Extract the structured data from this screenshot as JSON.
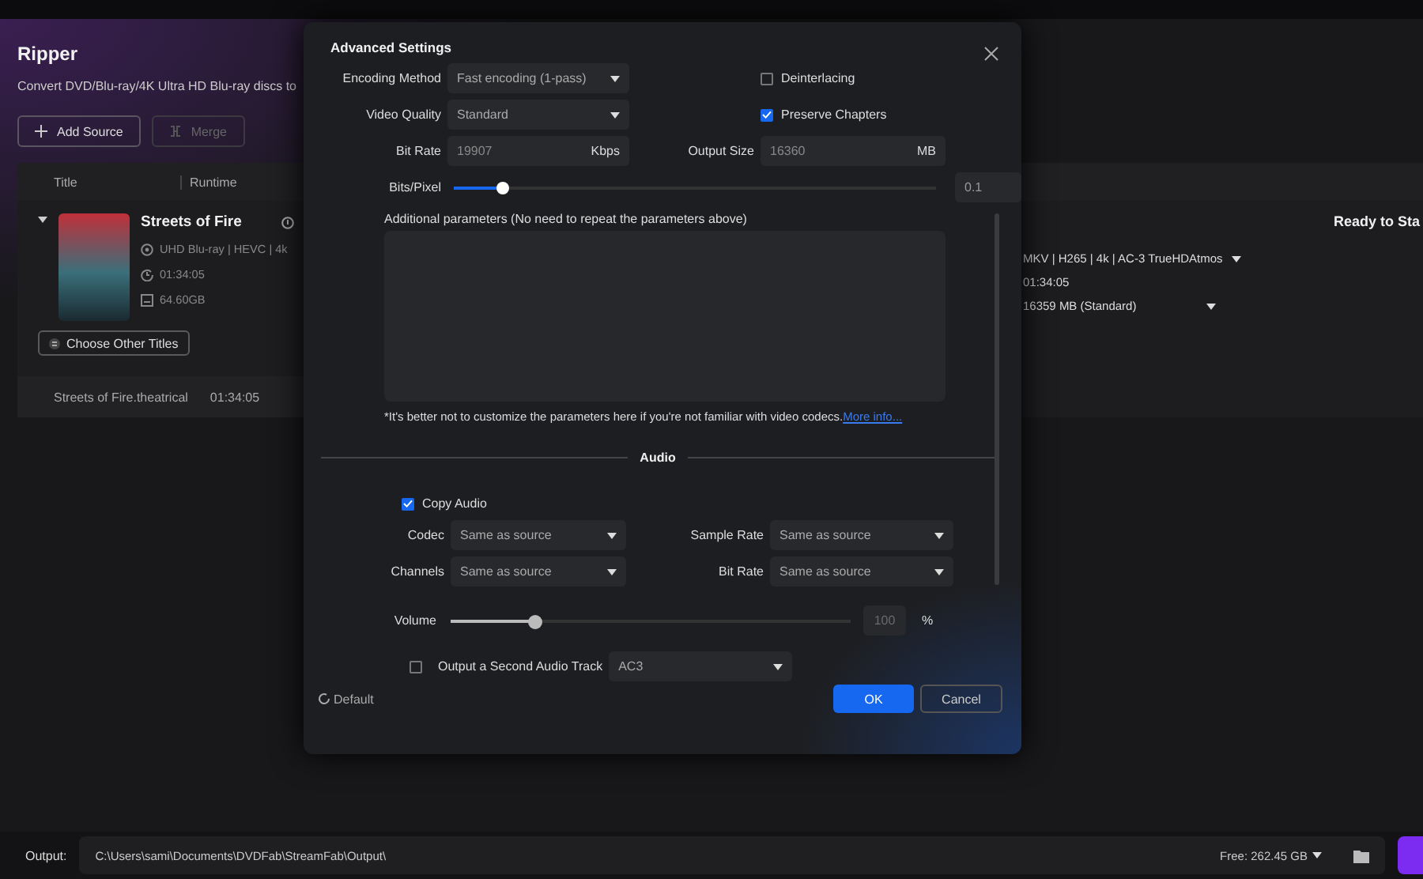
{
  "app": {
    "title": "Ripper",
    "subtitle": "Convert DVD/Blu-ray/4K Ultra HD Blu-ray discs to",
    "buttons": [
      {
        "label": "Add Source",
        "disabled": false
      },
      {
        "label": "Merge",
        "disabled": true
      }
    ]
  },
  "table": {
    "columns": [
      "Title",
      "Runtime"
    ],
    "source": {
      "expanded": true,
      "title": "Streets of Fire",
      "details": [
        "UHD Blu-ray | HEVC | 4k",
        "01:34:05",
        "64.60GB"
      ],
      "button": "Choose Other Titles",
      "profile": "MKV | H265 | 4k | AC-3 TrueHDAtmos",
      "runtime": "01:34:05",
      "size": "16359 MB (Standard)",
      "status": "Ready to Sta"
    },
    "titles": [
      {
        "name": "Streets of Fire.theatrical",
        "runtime": "01:34:05"
      }
    ]
  },
  "output": {
    "label": "Output:",
    "path": "C:\\Users\\sami\\Documents\\DVDFab\\StreamFab\\Output\\",
    "free": "Free: 262.45 GB"
  },
  "dialog": {
    "title": "Advanced Settings",
    "encoding_method": {
      "label": "Encoding Method",
      "value": "Fast encoding (1-pass)"
    },
    "deinterlacing": {
      "label": "Deinterlacing",
      "checked": false
    },
    "video_quality": {
      "label": "Video Quality",
      "value": "Standard"
    },
    "preserve_chapters": {
      "label": "Preserve Chapters",
      "checked": true
    },
    "bit_rate": {
      "label": "Bit Rate",
      "value": "19907",
      "unit": "Kbps"
    },
    "output_size": {
      "label": "Output Size",
      "value": "16360",
      "unit": "MB"
    },
    "bits_pixel": {
      "label": "Bits/Pixel",
      "level": 0.1,
      "value": "0.1"
    },
    "additional": {
      "label": "Additional parameters (No need to repeat the parameters above)",
      "note": "*It's better not to customize the parameters here if you're not familiar with video codecs.",
      "link": "More info..."
    },
    "audio": {
      "heading": "Audio",
      "copy_audio": {
        "label": "Copy Audio",
        "checked": true
      },
      "fields": [
        {
          "label": "Codec",
          "value": "Same as source"
        },
        {
          "label": "Sample Rate",
          "value": "Same as source"
        },
        {
          "label": "Channels",
          "value": "Same as source"
        },
        {
          "label": "Bit Rate",
          "value": "Same as source"
        }
      ],
      "volume": {
        "label": "Volume",
        "level": 0.21,
        "value": "100",
        "unit": "%",
        "disabled": true
      },
      "second_track": {
        "label": "Output a Second Audio Track",
        "checked": false,
        "value": "AC3"
      }
    },
    "footer": {
      "default": "Default",
      "ok": "OK",
      "cancel": "Cancel"
    }
  }
}
